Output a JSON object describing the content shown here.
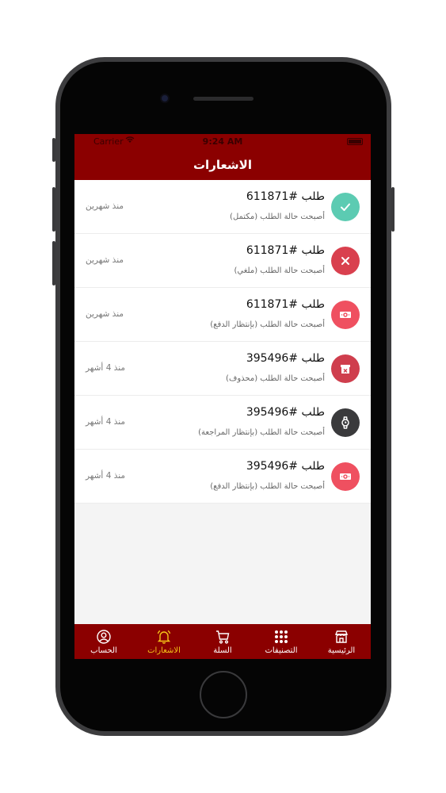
{
  "status_bar": {
    "carrier": "Carrier",
    "time": "9:24 AM"
  },
  "header": {
    "title": "الاشعارات"
  },
  "notifications": [
    {
      "order": "طلب #611871",
      "status": "أصبحت حالة الطلب (مكتمل)",
      "time": "منذ شهرين",
      "icon": "check-icon",
      "color": "#5ccbb2"
    },
    {
      "order": "طلب #611871",
      "status": "أصبحت حالة الطلب (ملغي)",
      "time": "منذ شهرين",
      "icon": "x-icon",
      "color": "#d9404e"
    },
    {
      "order": "طلب #611871",
      "status": "أصبحت حالة الطلب (بإنتظار الدفع)",
      "time": "منذ شهرين",
      "icon": "cash-icon",
      "color": "#ef5060"
    },
    {
      "order": "طلب #395496",
      "status": "أصبحت حالة الطلب (محذوف)",
      "time": "منذ 4 أشهر",
      "icon": "trash-box-icon",
      "color": "#cf3e4d"
    },
    {
      "order": "طلب #395496",
      "status": "أصبحت حالة الطلب (بإنتظار المراجعة)",
      "time": "منذ 4 أشهر",
      "icon": "watch-icon",
      "color": "#3a3a3c"
    },
    {
      "order": "طلب #395496",
      "status": "أصبحت حالة الطلب (بإنتظار الدفع)",
      "time": "منذ 4 أشهر",
      "icon": "cash-icon",
      "color": "#ef5060"
    }
  ],
  "tabbar": {
    "home": "الرئيسية",
    "categories": "التصنيفات",
    "cart": "السلة",
    "notifications": "الاشعارات",
    "account": "الحساب",
    "active_color": "#f5c518"
  },
  "colors": {
    "brand": "#8b0000"
  }
}
